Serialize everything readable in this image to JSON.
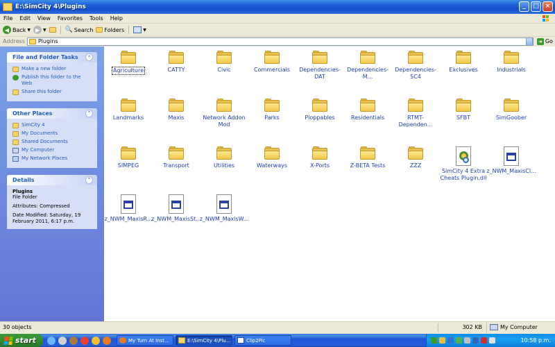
{
  "window": {
    "title": "E:\\SimCity 4\\Plugins",
    "controls": {
      "minimize": "_",
      "maximize": "□",
      "close": "×"
    }
  },
  "menu": [
    "File",
    "Edit",
    "View",
    "Favorites",
    "Tools",
    "Help"
  ],
  "toolbar": {
    "back_label": "Back",
    "search_label": "Search",
    "folders_label": "Folders"
  },
  "address": {
    "label": "Address",
    "value": "Plugins",
    "go_label": "Go"
  },
  "tasks_panel": {
    "title": "File and Folder Tasks",
    "items": [
      "Make a new folder",
      "Publish this folder to the Web",
      "Share this folder"
    ]
  },
  "places_panel": {
    "title": "Other Places",
    "items": [
      "SimCity 4",
      "My Documents",
      "Shared Documents",
      "My Computer",
      "My Network Places"
    ]
  },
  "details_panel": {
    "title": "Details",
    "name": "Plugins",
    "type": "File Folder",
    "attributes": "Attributes: Compressed",
    "date": "Date Modified: Saturday, 19 February 2011, 6:17 p.m."
  },
  "items": [
    {
      "label": "Agriculture",
      "kind": "folder"
    },
    {
      "label": "CATTY",
      "kind": "folder"
    },
    {
      "label": "Civic",
      "kind": "folder"
    },
    {
      "label": "Commercials",
      "kind": "folder"
    },
    {
      "label": "Dependencies-DAT",
      "kind": "folder"
    },
    {
      "label": "Dependencies-M...",
      "kind": "folder"
    },
    {
      "label": "Dependencies-SC4",
      "kind": "folder"
    },
    {
      "label": "Exclusives",
      "kind": "folder"
    },
    {
      "label": "Industrials",
      "kind": "folder"
    },
    {
      "label": "Landmarks",
      "kind": "folder"
    },
    {
      "label": "Maxis",
      "kind": "folder"
    },
    {
      "label": "Network Addon Mod",
      "kind": "folder"
    },
    {
      "label": "Parks",
      "kind": "folder"
    },
    {
      "label": "Ploppables",
      "kind": "folder"
    },
    {
      "label": "Residentials",
      "kind": "folder"
    },
    {
      "label": "RTMT-Dependen...",
      "kind": "folder"
    },
    {
      "label": "SFBT",
      "kind": "folder"
    },
    {
      "label": "SimGoober",
      "kind": "folder"
    },
    {
      "label": "SIMPEG",
      "kind": "folder"
    },
    {
      "label": "Transport",
      "kind": "folder"
    },
    {
      "label": "Utilities",
      "kind": "folder"
    },
    {
      "label": "Waterways",
      "kind": "folder"
    },
    {
      "label": "X-Ports",
      "kind": "folder"
    },
    {
      "label": "Z-BETA Tests",
      "kind": "folder"
    },
    {
      "label": "ZZZ",
      "kind": "folder"
    },
    {
      "label": "SimCity 4 Extra Cheats Plugin.dll",
      "kind": "dll"
    },
    {
      "label": "z_NWM_MaxisCl...",
      "kind": "file"
    },
    {
      "label": "z_NWM_MaxisR...",
      "kind": "file"
    },
    {
      "label": "z_NWM_MaxisSt...",
      "kind": "file"
    },
    {
      "label": "z_NWM_MaxisW...",
      "kind": "file"
    }
  ],
  "status": {
    "objects": "30 objects",
    "size": "302 KB",
    "location": "My Computer"
  },
  "taskbar": {
    "start_label": "start",
    "tasks": [
      "My Turn At Inst...",
      "E:\\SimCity 4\\Plu...",
      "Clip2Pic"
    ],
    "clock": "10:58 p.m."
  }
}
